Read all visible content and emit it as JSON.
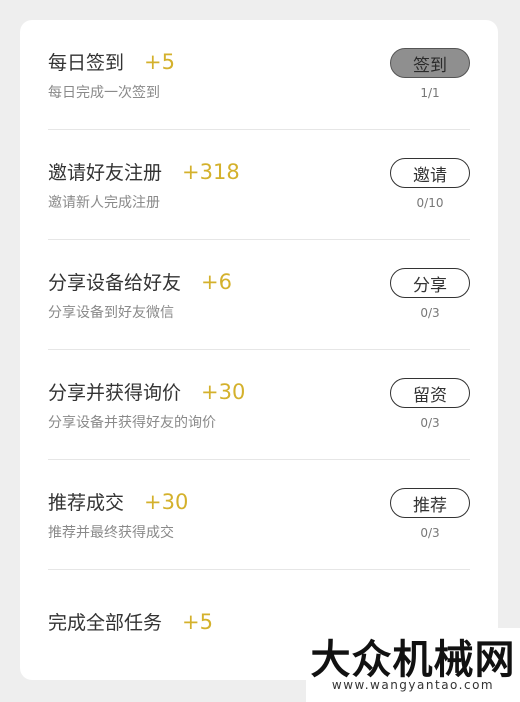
{
  "tasks": [
    {
      "title": "每日签到",
      "points": "+5",
      "desc": "每日完成一次签到",
      "button": "签到",
      "progress": "1/1"
    },
    {
      "title": "邀请好友注册",
      "points": "+318",
      "desc": "邀请新人完成注册",
      "button": "邀请",
      "progress": "0/10"
    },
    {
      "title": "分享设备给好友",
      "points": "+6",
      "desc": "分享设备到好友微信",
      "button": "分享",
      "progress": "0/3"
    },
    {
      "title": "分享并获得询价",
      "points": "+30",
      "desc": "分享设备并获得好友的询价",
      "button": "留资",
      "progress": "0/3"
    },
    {
      "title": "推荐成交",
      "points": "+30",
      "desc": "推荐并最终获得成交",
      "button": "推荐",
      "progress": "0/3"
    },
    {
      "title": "完成全部任务",
      "points": "+5"
    }
  ],
  "watermark": {
    "text": "大众机械网",
    "url": "www.wangyantao.com"
  },
  "colors": {
    "points": "#d4b12c",
    "done_button": "#8f8f8f"
  }
}
